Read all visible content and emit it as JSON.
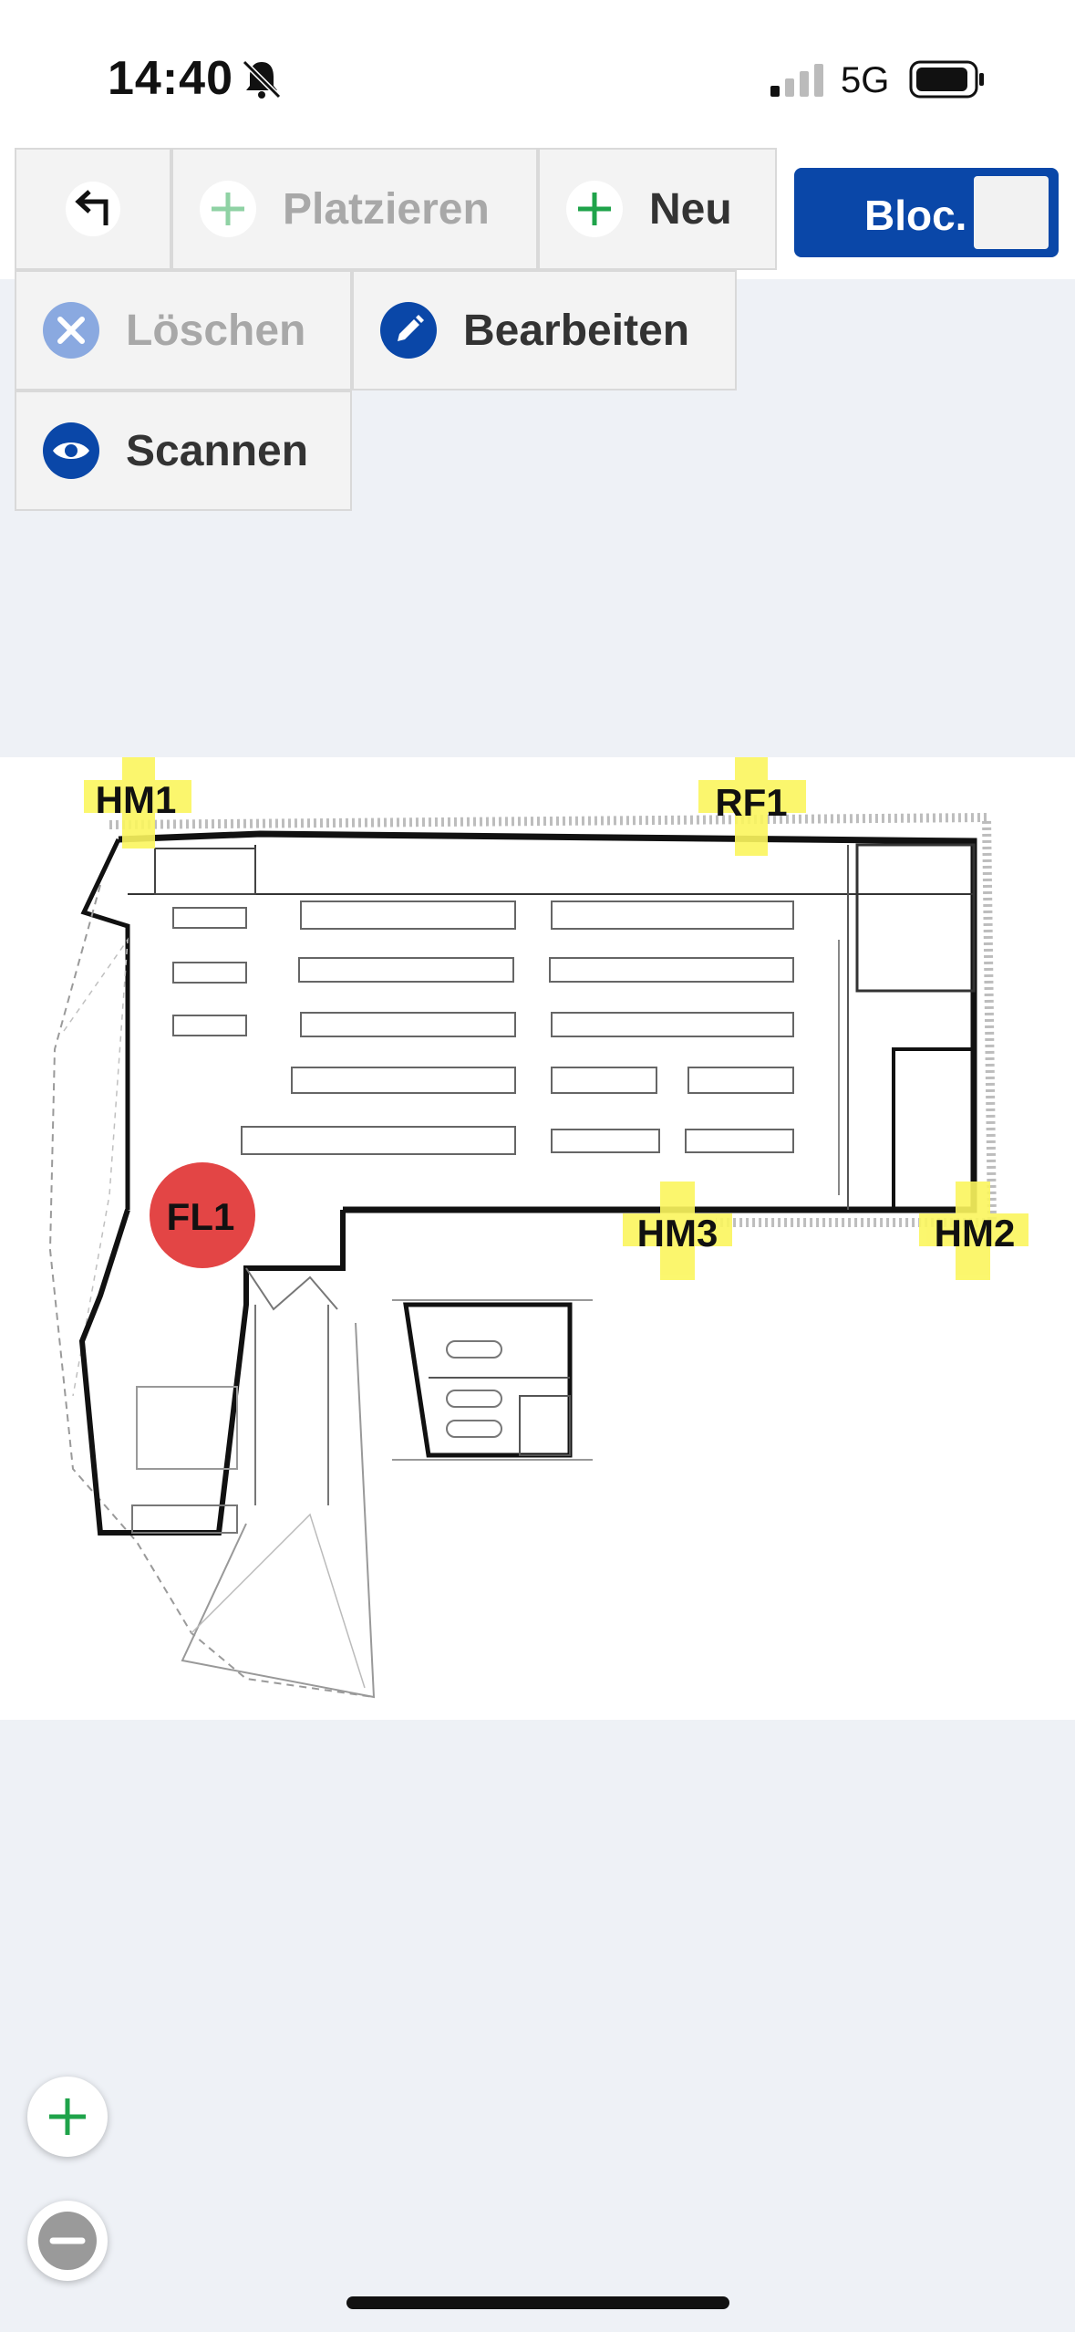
{
  "status_bar": {
    "time": "14:40",
    "network": "5G",
    "icons": [
      "bell-off-icon",
      "signal-icon",
      "battery-icon"
    ]
  },
  "toolbar": {
    "back": {
      "icon": "back-arrow-icon"
    },
    "place": {
      "label": "Platzieren",
      "icon": "plus-icon",
      "enabled": false
    },
    "new": {
      "label": "Neu",
      "icon": "plus-icon",
      "enabled": true
    },
    "mode_toggle": {
      "label": "Bloc.",
      "on": true
    },
    "delete": {
      "label": "Löschen",
      "icon": "x-circle-icon",
      "enabled": false
    },
    "edit": {
      "label": "Bearbeiten",
      "icon": "pencil-icon",
      "enabled": true
    },
    "scan": {
      "label": "Scannen",
      "icon": "eye-icon",
      "enabled": true
    }
  },
  "floor_plan": {
    "markers": [
      {
        "id": "HM1",
        "kind": "highlight"
      },
      {
        "id": "RF1",
        "kind": "highlight"
      },
      {
        "id": "HM3",
        "kind": "highlight"
      },
      {
        "id": "HM2",
        "kind": "highlight"
      },
      {
        "id": "FL1",
        "kind": "selected"
      }
    ]
  },
  "zoom": {
    "in_icon": "plus-icon",
    "out_icon": "minus-icon"
  },
  "colors": {
    "brand_blue": "#0a47a8",
    "green_plus": "#1fa34a",
    "marker_highlight": "#fbf65e",
    "marker_selected": "#e23b3b",
    "background": "#eef1f6"
  }
}
